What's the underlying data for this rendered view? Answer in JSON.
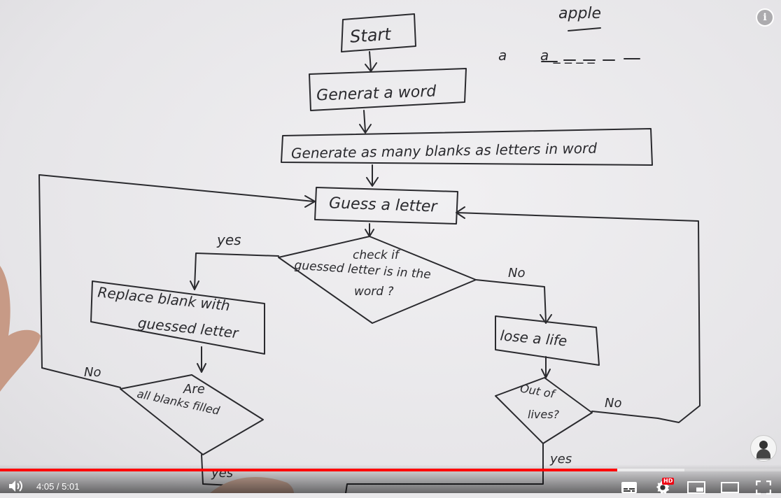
{
  "video": {
    "current_time": "4:05",
    "separator": " / ",
    "duration": "5:01",
    "progress_played": 0.79,
    "progress_buffered": 0.876,
    "hd_badge": "HD",
    "info_icon": "i"
  },
  "whiteboard": {
    "top_word": "apple",
    "top_letter": "a",
    "blank_row": "a _ _ _ _",
    "nodes": {
      "start": "Start",
      "generate_word": "Generat a word",
      "generate_blanks": "Generate as many blanks as letters in word",
      "guess_letter": "Guess a letter",
      "check_line1": "check if",
      "check_line2": "guessed letter is in the",
      "check_line3": "word ?",
      "replace_line1": "Replace blank with",
      "replace_line2": "guessed letter",
      "lose_life": "lose a life",
      "filled_line1": "Are",
      "filled_line2": "all blanks filled",
      "lives_line1": "Out of",
      "lives_line2": "lives?"
    },
    "edge_labels": {
      "yes_check": "yes",
      "no_check": "No",
      "no_filled": "No",
      "no_lives": "No",
      "yes_lives": "yes",
      "yes_filled": "yes"
    }
  },
  "colors": {
    "progress": "#ff0000",
    "marker": "#2a2a2e"
  },
  "icons": [
    "info-icon",
    "volume-icon",
    "subtitles-icon",
    "settings-icon",
    "miniplayer-icon",
    "theater-mode-icon",
    "fullscreen-icon"
  ]
}
